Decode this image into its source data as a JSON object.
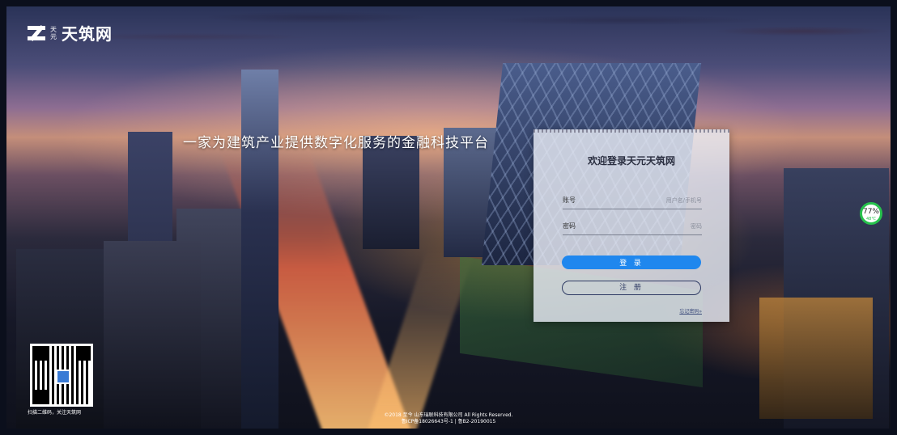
{
  "brand": {
    "small": "天元",
    "name": "天筑网"
  },
  "hero": {
    "slogan": "一家为建筑产业提供数字化服务的金融科技平台"
  },
  "login": {
    "title": "欢迎登录天元天筑网",
    "account_label": "账号",
    "account_placeholder": "用户名/手机号",
    "password_label": "密码",
    "password_placeholder": "密码",
    "login_button": "登 录",
    "register_button": "注 册",
    "forgot_link": "忘记密码»"
  },
  "badge": {
    "percent": "77%",
    "temp": "48℃"
  },
  "qr": {
    "caption": "扫描二维码，关注天筑网"
  },
  "footer": {
    "copyright": "©2018 至今 山东瑞联科技有限公司 All Rights Reserved.",
    "icp": "鲁ICP备18026643号-1 | 鲁B2-20190015"
  }
}
